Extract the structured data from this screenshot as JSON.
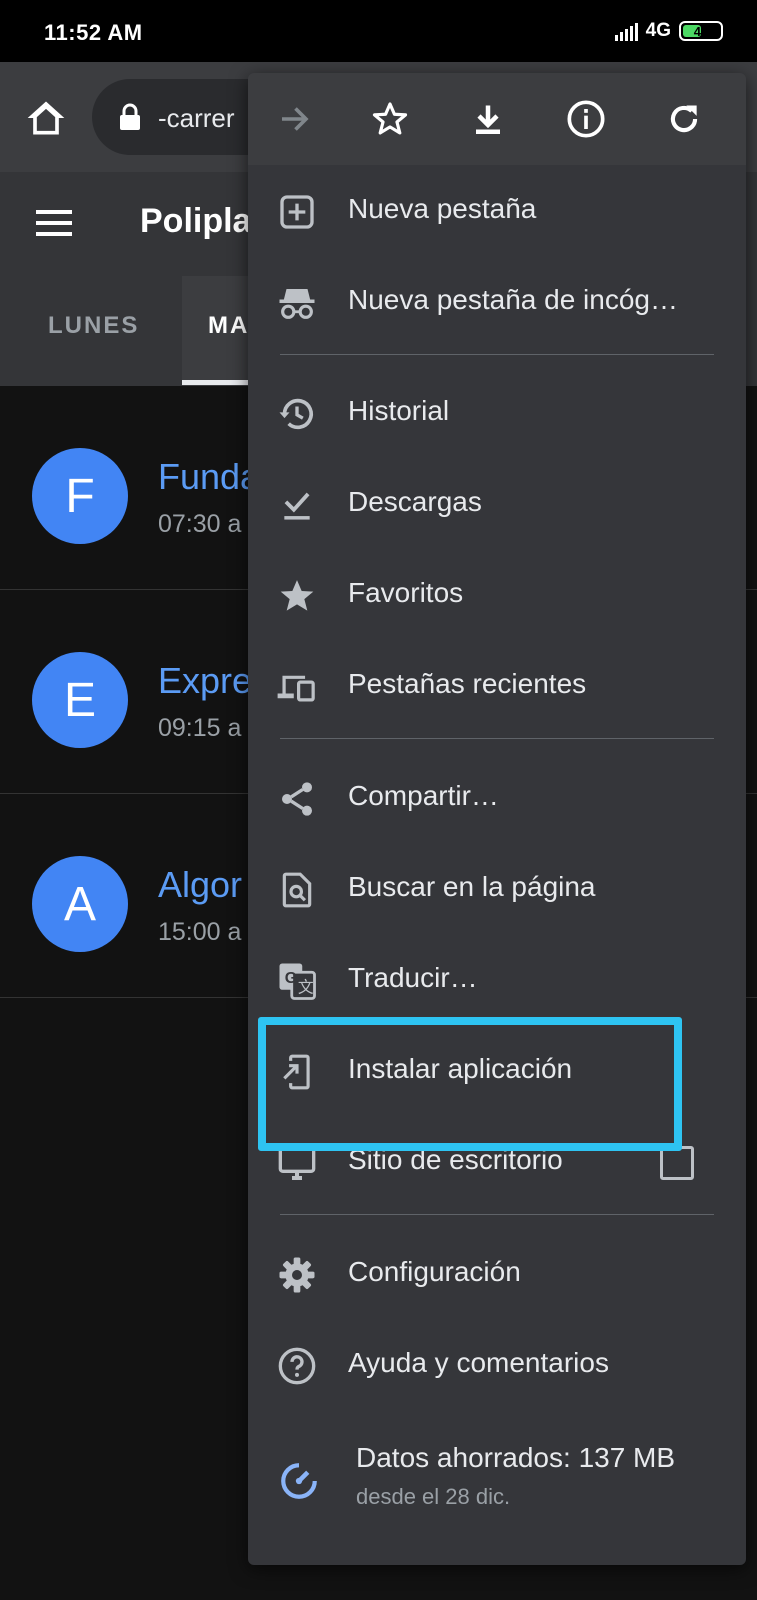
{
  "status_bar": {
    "time": "11:52 AM",
    "network": "4G",
    "battery": "48"
  },
  "browser": {
    "url": "-carrer"
  },
  "app": {
    "title": "Polipla"
  },
  "tabs": [
    {
      "label": "LUNES"
    },
    {
      "label": "MA"
    }
  ],
  "list": [
    {
      "initial": "F",
      "title": "Funda",
      "subtitle": "07:30 a"
    },
    {
      "initial": "E",
      "title": "Expre",
      "subtitle": "09:15 a"
    },
    {
      "initial": "A",
      "title": "Algor",
      "subtitle": "15:00 a"
    }
  ],
  "menu": {
    "toolbar": [
      "forward-icon",
      "star-icon",
      "download-icon",
      "info-icon",
      "refresh-icon"
    ],
    "items": [
      {
        "label": "Nueva pestaña",
        "icon": "new-tab-icon"
      },
      {
        "label": "Nueva pestaña de incóg…",
        "icon": "incognito-icon"
      },
      {
        "label": "Historial",
        "icon": "history-icon"
      },
      {
        "label": "Descargas",
        "icon": "downloads-icon"
      },
      {
        "label": "Favoritos",
        "icon": "star-icon"
      },
      {
        "label": "Pestañas recientes",
        "icon": "devices-icon"
      },
      {
        "label": "Compartir…",
        "icon": "share-icon"
      },
      {
        "label": "Buscar en la página",
        "icon": "find-in-page-icon"
      },
      {
        "label": "Traducir…",
        "icon": "translate-icon"
      },
      {
        "label": "Instalar aplicación",
        "icon": "install-app-icon"
      },
      {
        "label": "Sitio de escritorio",
        "icon": "desktop-icon"
      },
      {
        "label": "Configuración",
        "icon": "settings-icon"
      },
      {
        "label": "Ayuda y comentarios",
        "icon": "help-icon"
      }
    ],
    "data_saver": {
      "title": "Datos ahorrados: 137 MB",
      "subtitle": "desde el 28 dic."
    }
  },
  "colors": {
    "highlight": "#2ec4f2",
    "accent": "#5b9bf4",
    "avatar": "#4285f4",
    "menu_bg": "#35363a"
  }
}
